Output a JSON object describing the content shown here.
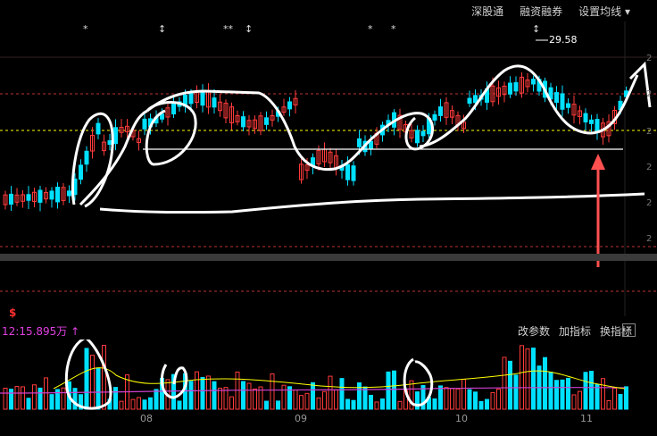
{
  "toolbar": {
    "items": [
      "深股通",
      "融资融券",
      "设置均线 ▾"
    ]
  },
  "price_note": "29.58",
  "vol_label": "12:15.895万 ↑",
  "indicator_bar": {
    "items": [
      "改参数",
      "加指标",
      "换指标"
    ]
  },
  "close_icon": "×",
  "dollar_mark": "$",
  "months": [
    "08",
    "09",
    "10",
    "11"
  ],
  "markers": [
    "*",
    "↕",
    "**",
    "↕",
    "*",
    "*",
    "↕"
  ],
  "colors": {
    "up": "#ff3b3b",
    "down": "#00e0ff",
    "ma": "#ffff00",
    "bg": "#000000"
  }
}
